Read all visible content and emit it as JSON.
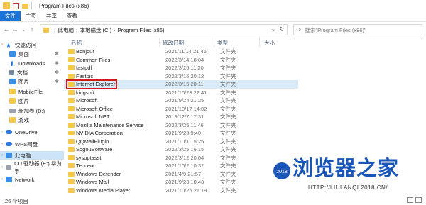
{
  "window": {
    "title": "Program Files (x86)"
  },
  "ribbon": {
    "tabs": [
      "文件",
      "主页",
      "共享",
      "查看"
    ]
  },
  "address": {
    "crumbs": [
      "此电脑",
      "本地磁盘 (C:)",
      "Program Files (x86)"
    ],
    "separator": "›"
  },
  "search": {
    "placeholder": "搜索\"Program Files (x86)\""
  },
  "sidebar": {
    "items": [
      {
        "label": "快速访问",
        "icon": "star-icon",
        "color": "#1a73d6"
      },
      {
        "label": "桌面",
        "icon": "desktop-icon",
        "color": "#3a8ee6",
        "pinned": true
      },
      {
        "label": "Downloads",
        "icon": "download-icon",
        "color": "#1a73d6",
        "pinned": true
      },
      {
        "label": "文档",
        "icon": "document-icon",
        "color": "#7a8aa0",
        "pinned": true
      },
      {
        "label": "图片",
        "icon": "picture-icon",
        "color": "#3a8ee6",
        "pinned": true
      },
      {
        "label": "MobileFile",
        "icon": "folder-icon",
        "color": "#f4c84b"
      },
      {
        "label": "图片",
        "icon": "folder-icon",
        "color": "#f4c84b"
      },
      {
        "label": "新加卷 (D:)",
        "icon": "drive-icon",
        "color": "#9aa3ad"
      },
      {
        "label": "游戏",
        "icon": "folder-icon",
        "color": "#f4c84b"
      },
      {
        "label": "OneDrive",
        "icon": "cloud-icon",
        "color": "#2b74d9"
      },
      {
        "label": "WPS网盘",
        "icon": "cloud-icon",
        "color": "#2b74d9"
      },
      {
        "label": "此电脑",
        "icon": "computer-icon",
        "color": "#3a8ee6",
        "selected": true
      },
      {
        "label": "CD 驱动器 (E:) 华为手",
        "icon": "cd-drive-icon",
        "color": "#9aa3ad"
      },
      {
        "label": "Network",
        "icon": "network-icon",
        "color": "#3a8ee6"
      }
    ]
  },
  "columns": {
    "name": "名称",
    "date": "修改日期",
    "type": "类型",
    "size": "大小"
  },
  "files": [
    {
      "name": "Bonjour",
      "date": "2021/11/14 21:46",
      "type": "文件夹"
    },
    {
      "name": "Common Files",
      "date": "2022/3/14 18:04",
      "type": "文件夹"
    },
    {
      "name": "fastpdf",
      "date": "2022/3/25 11:20",
      "type": "文件夹"
    },
    {
      "name": "Fastpic",
      "date": "2022/3/15 20:12",
      "type": "文件夹"
    },
    {
      "name": "Internet Explorer",
      "date": "2022/3/15 20:11",
      "type": "文件夹",
      "selected": true
    },
    {
      "name": "kingsoft",
      "date": "2021/10/23 22:41",
      "type": "文件夹"
    },
    {
      "name": "Microsoft",
      "date": "2021/9/24 21:25",
      "type": "文件夹"
    },
    {
      "name": "Microsoft Office",
      "date": "2021/10/17 14:02",
      "type": "文件夹"
    },
    {
      "name": "Microsoft.NET",
      "date": "2019/12/7 17:31",
      "type": "文件夹"
    },
    {
      "name": "Mozilla Maintenance Service",
      "date": "2022/3/25 11:46",
      "type": "文件夹"
    },
    {
      "name": "NVIDIA Corporation",
      "date": "2021/9/23 9:40",
      "type": "文件夹"
    },
    {
      "name": "QQMailPlugin",
      "date": "2021/10/1 15:25",
      "type": "文件夹"
    },
    {
      "name": "SogouSoftware",
      "date": "2022/3/25 16:15",
      "type": "文件夹"
    },
    {
      "name": "sysoptasst",
      "date": "2022/3/12 20:04",
      "type": "文件夹"
    },
    {
      "name": "Tencent",
      "date": "2021/10/2 10:32",
      "type": "文件夹"
    },
    {
      "name": "Windows Defender",
      "date": "2021/4/9 21:57",
      "type": "文件夹"
    },
    {
      "name": "Windows Mail",
      "date": "2021/9/23 10:43",
      "type": "文件夹"
    },
    {
      "name": "Windows Media Player",
      "date": "2021/10/25 21:19",
      "type": "文件夹"
    }
  ],
  "status": {
    "item_count": "26 个项目"
  },
  "watermark": {
    "text": "浏览器之家",
    "url": "HTTP://LIULANQI.2018.CN/",
    "badge": "2018"
  }
}
